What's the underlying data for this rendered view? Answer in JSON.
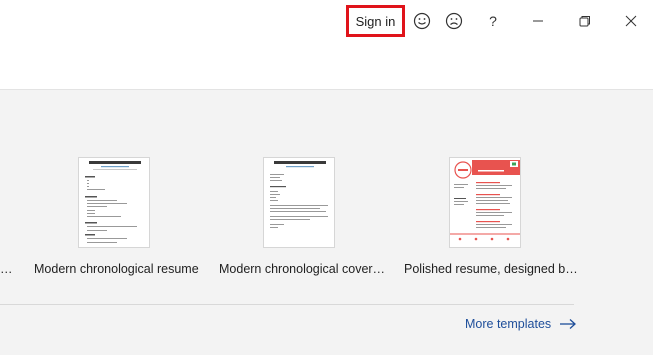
{
  "titlebar": {
    "sign_in_label": "Sign in",
    "icons": [
      "smile-icon",
      "frown-icon",
      "help-icon",
      "minimize-icon",
      "restore-icon",
      "close-icon"
    ],
    "help_glyph": "?"
  },
  "templates": {
    "left_cut_caption": "…",
    "items": [
      {
        "caption": "Modern chronological resume"
      },
      {
        "caption": "Modern chronological cover…"
      },
      {
        "caption": "Polished resume, designed b…"
      }
    ]
  },
  "footer": {
    "more_templates_label": "More templates"
  },
  "colors": {
    "accent_red": "#e0131a",
    "link_blue": "#1e4e9a",
    "template_red": "#e8534f"
  }
}
